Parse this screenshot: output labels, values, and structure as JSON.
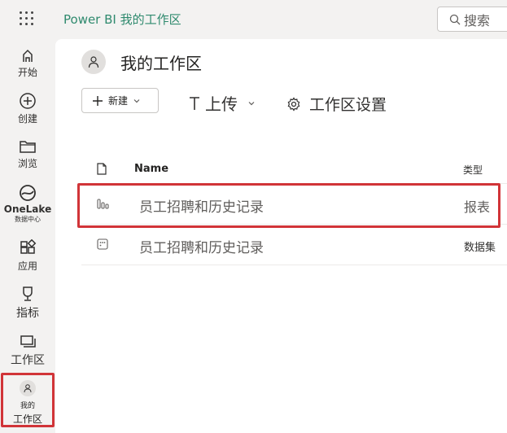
{
  "app": {
    "title": "Power BI 我的工作区"
  },
  "search": {
    "label": "搜索"
  },
  "rail": {
    "home": "开始",
    "create": "创建",
    "browse": "浏览",
    "onelake_line1": "OneLake",
    "onelake_line2": "数据中心",
    "apps": "应用",
    "metrics": "指标",
    "workspaces": "工作区",
    "my_ws_line1": "我的",
    "my_ws_line2": "工作区"
  },
  "workspace": {
    "title": "我的工作区",
    "new_label": "新建",
    "upload_label": "上传",
    "settings_label": "工作区设置"
  },
  "table": {
    "col_name": "Name",
    "col_type": "类型",
    "rows": [
      {
        "name": "员工招聘和历史记录",
        "type": "报表"
      },
      {
        "name": "员工招聘和历史记录",
        "type": "数据集"
      }
    ]
  },
  "colors": {
    "accent": "#2f8a6e",
    "highlight": "#d13438"
  }
}
